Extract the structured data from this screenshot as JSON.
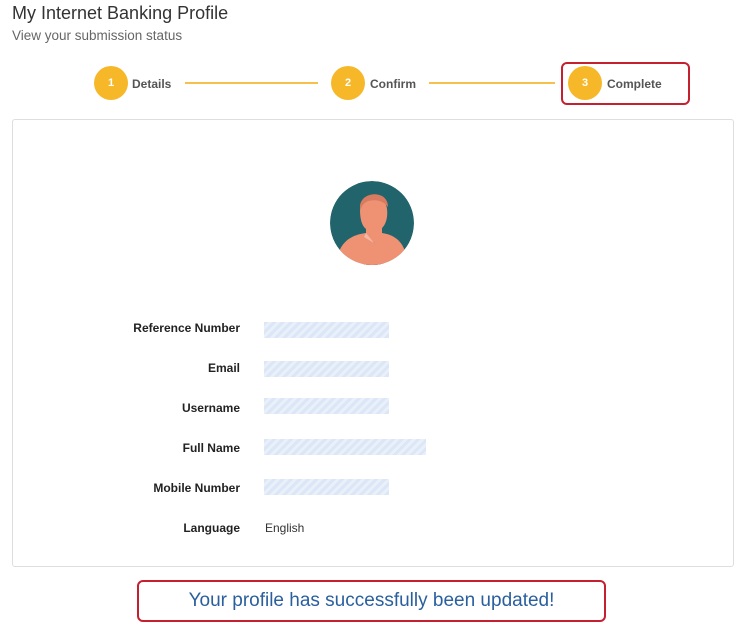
{
  "header": {
    "title": "My Internet Banking Profile",
    "subtitle": "View your submission status"
  },
  "stepper": {
    "steps": [
      {
        "number": "1",
        "label": "Details"
      },
      {
        "number": "2",
        "label": "Confirm"
      },
      {
        "number": "3",
        "label": "Complete"
      }
    ],
    "active_step": 3,
    "accent_color": "#f6b829"
  },
  "profile": {
    "avatar_icon": "person-avatar-icon",
    "fields": [
      {
        "label": "Reference Number",
        "value": null,
        "redacted": true
      },
      {
        "label": "Email",
        "value": null,
        "redacted": true
      },
      {
        "label": "Username",
        "value": null,
        "redacted": true
      },
      {
        "label": "Full Name",
        "value": null,
        "redacted": true
      },
      {
        "label": "Mobile Number",
        "value": null,
        "redacted": true
      },
      {
        "label": "Language",
        "value": "English",
        "redacted": false
      }
    ]
  },
  "status": {
    "message": "Your profile has successfully been updated!",
    "color": "#2a5f9e",
    "highlight_color": "#c4202f"
  }
}
